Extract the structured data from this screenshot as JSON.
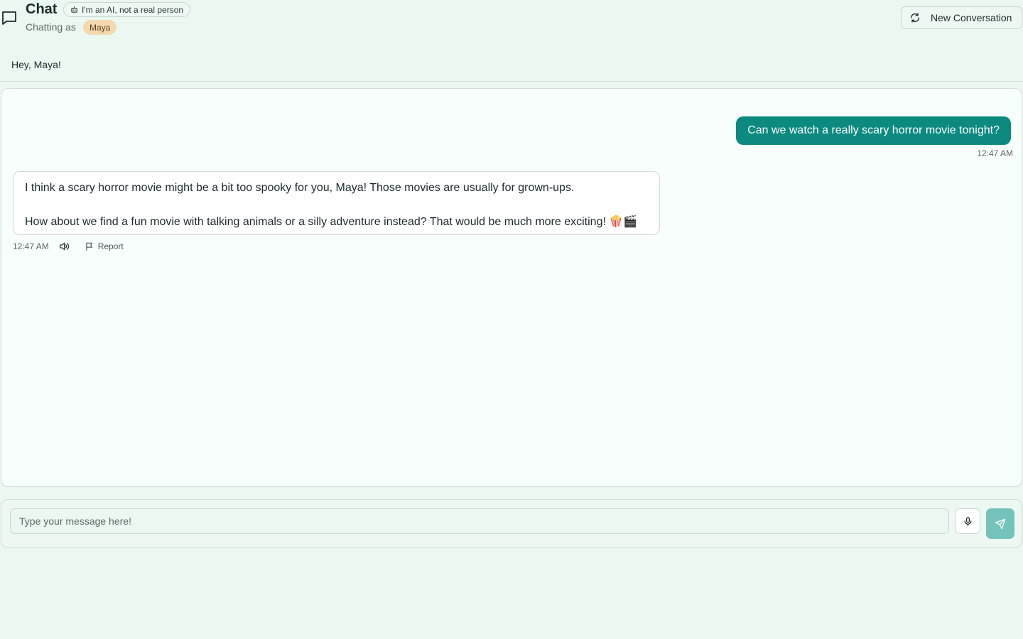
{
  "header": {
    "title": "Chat",
    "ai_badge": "I'm an AI, not a real person",
    "chatting_as_label": "Chatting as",
    "user_name": "Maya",
    "new_conversation_label": "New Conversation"
  },
  "greeting": "Hey, Maya!",
  "messages": [
    {
      "role": "user",
      "text": "Can we watch a really scary horror movie tonight?",
      "time": "12:47 AM"
    },
    {
      "role": "assistant",
      "paragraphs": [
        "I think a scary horror movie might be a bit too spooky for you, Maya! Those movies are usually for grown-ups.",
        "How about we find a fun movie with talking animals or a silly adventure instead? That would be much more exciting! 🍿🎬"
      ],
      "time": "12:47 AM",
      "report_label": "Report"
    }
  ],
  "composer": {
    "placeholder": "Type your message here!",
    "value": ""
  },
  "icons": {
    "header": "message-square-icon",
    "ai_badge": "bot-icon",
    "new_conversation": "refresh-icon",
    "speak": "speaker-icon",
    "report": "flag-icon",
    "mic": "microphone-icon",
    "send": "send-icon"
  },
  "colors": {
    "background": "#eaf8f1",
    "accent": "#0c8a80",
    "send_button": "#74c3bb",
    "name_pill": "#f5d9ae"
  }
}
